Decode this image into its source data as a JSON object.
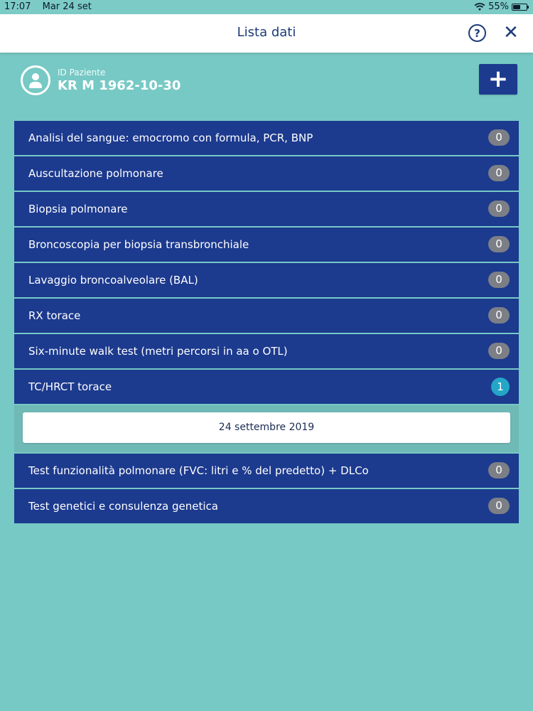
{
  "status_bar": {
    "time": "17:07",
    "date": "Mar 24 set",
    "battery": "55%",
    "battery_level": 0.55
  },
  "nav": {
    "title": "Lista dati"
  },
  "patient": {
    "label": "ID Paziente",
    "id": "KR M 1962-10-30"
  },
  "add_button": "+",
  "items": [
    {
      "label": "Analisi del sangue: emocromo con formula, PCR, BNP",
      "count": "0"
    },
    {
      "label": "Auscultazione polmonare",
      "count": "0"
    },
    {
      "label": "Biopsia polmonare",
      "count": "0"
    },
    {
      "label": "Broncoscopia per biopsia transbronchiale",
      "count": "0"
    },
    {
      "label": "Lavaggio broncoalveolare (BAL)",
      "count": "0"
    },
    {
      "label": "RX torace",
      "count": "0"
    },
    {
      "label": "Six-minute walk test (metri percorsi in aa o OTL)",
      "count": "0"
    },
    {
      "label": "TC/HRCT torace",
      "count": "1",
      "entries": [
        "24 settembre 2019"
      ]
    },
    {
      "label": "Test funzionalità polmonare (FVC: litri e % del predetto) + DLCo",
      "count": "0"
    },
    {
      "label": "Test genetici e consulenza genetica",
      "count": "0"
    }
  ],
  "colors": {
    "background": "#77c9c5",
    "row": "#1c3a8e",
    "badge_zero": "#7d7f86",
    "badge_active": "#23a6c7",
    "nav_text": "#1c3a7a"
  }
}
